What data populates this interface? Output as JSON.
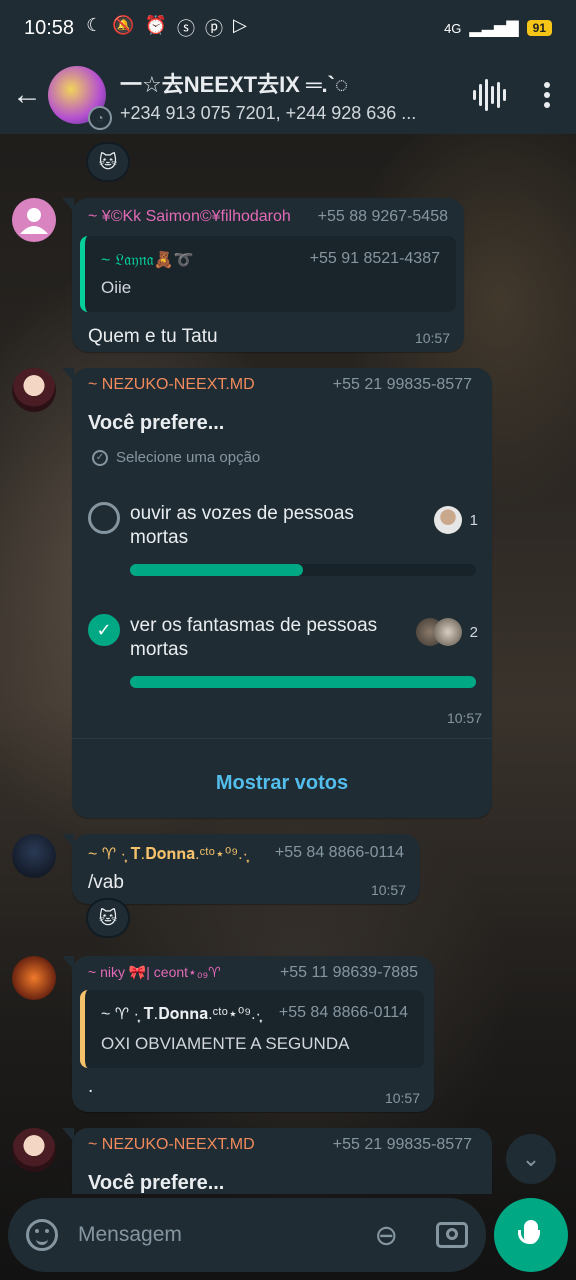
{
  "status_bar": {
    "time": "10:58",
    "network": "4G",
    "battery": "91"
  },
  "header": {
    "title": "一☆去NEEXT去IX ═.`◌",
    "subtitle": "+234 913 075 7201, +244 928 636 ...",
    "icons": [
      "back-arrow-icon",
      "voice-call-icon",
      "more-options-icon"
    ]
  },
  "messages": [
    {
      "reaction": "🐱"
    },
    {
      "sender": "~ ¥©Kk Saimon©¥filhodaroh",
      "phone": "+55 88 9267-5458",
      "quote": {
        "sender": "~ 𝔏𝔞𝔶𝔫𝔞🧸➰",
        "phone": "+55 91 8521-4387",
        "text": "Oiie"
      },
      "text": "Quem e tu Tatu",
      "time": "10:57"
    },
    {
      "sender": "~ NEZUKO-NEEXT.MD",
      "phone": "+55 21 99835-8577",
      "poll": {
        "question": "Você prefere...",
        "hint": "Selecione uma opção",
        "options": [
          {
            "text": "ouvir as vozes de pessoas mortas",
            "votes": "1",
            "fraction": 0.5,
            "checked": false
          },
          {
            "text": "ver os fantasmas de pessoas mortas",
            "votes": "2",
            "fraction": 1.0,
            "checked": true
          }
        ],
        "time": "10:57",
        "show_votes": "Mostrar votos"
      }
    },
    {
      "sender": "~ ♈ ·̩͙ 𝐓.𝐃𝐨𝐧𝐧𝐚.ᶜᵗᵒ⋆⁰⁹.·̩͙",
      "phone": "+55 84 8866-0114",
      "text": "/vab",
      "time": "10:57",
      "reaction": "🐱"
    },
    {
      "sender": "~ niky 🎀| ceont⋆₀₉♈",
      "phone": "+55 11 98639-7885",
      "quote": {
        "sender": "~ ♈ ·̩͙ 𝐓.𝐃𝐨𝐧𝐧𝐚.ᶜᵗᵒ⋆⁰⁹.·̩͙",
        "phone": "+55 84 8866-0114",
        "text": "OXI OBVIAMENTE A SEGUNDA"
      },
      "text": ".",
      "time": "10:57"
    },
    {
      "sender": "~ NEZUKO-NEEXT.MD",
      "phone": "+55 21 99835-8577",
      "text": "Você prefere..."
    }
  ],
  "input": {
    "placeholder": "Mensagem"
  },
  "colors": {
    "accent": "#00a884",
    "bubble": "#1f2c34",
    "link": "#53bdeb"
  }
}
